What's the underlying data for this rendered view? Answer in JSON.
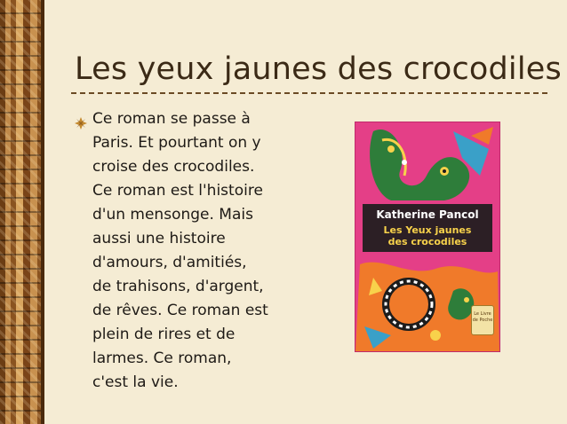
{
  "slide": {
    "title": "Les yeux jaunes des crocodiles",
    "bullet_icon": "diamond-flower-bullet-icon",
    "body_lines": [
      "Ce roman se passe à",
      "Paris. Et pourtant on y",
      "croise des crocodiles.",
      "Ce roman est l'histoire",
      "d'un mensonge. Mais",
      "aussi une histoire",
      "d'amours, d'amitiés,",
      "de trahisons, d'argent,",
      "de rêves. Ce roman est",
      "plein de rires et de",
      "larmes. Ce roman,",
      "c'est la vie."
    ]
  },
  "book_cover": {
    "author": "Katherine  Pancol",
    "title_line1": "Les Yeux jaunes",
    "title_line2": "des crocodiles",
    "publisher_logo": "Le Livre de Poche",
    "colors": {
      "background": "#e43f87",
      "title": "#f8d24b",
      "author": "#ffffff"
    }
  },
  "colors": {
    "background": "#f5ecd4",
    "title": "#3b2a16",
    "text": "#1e1a16",
    "rule": "#6b4a24"
  }
}
